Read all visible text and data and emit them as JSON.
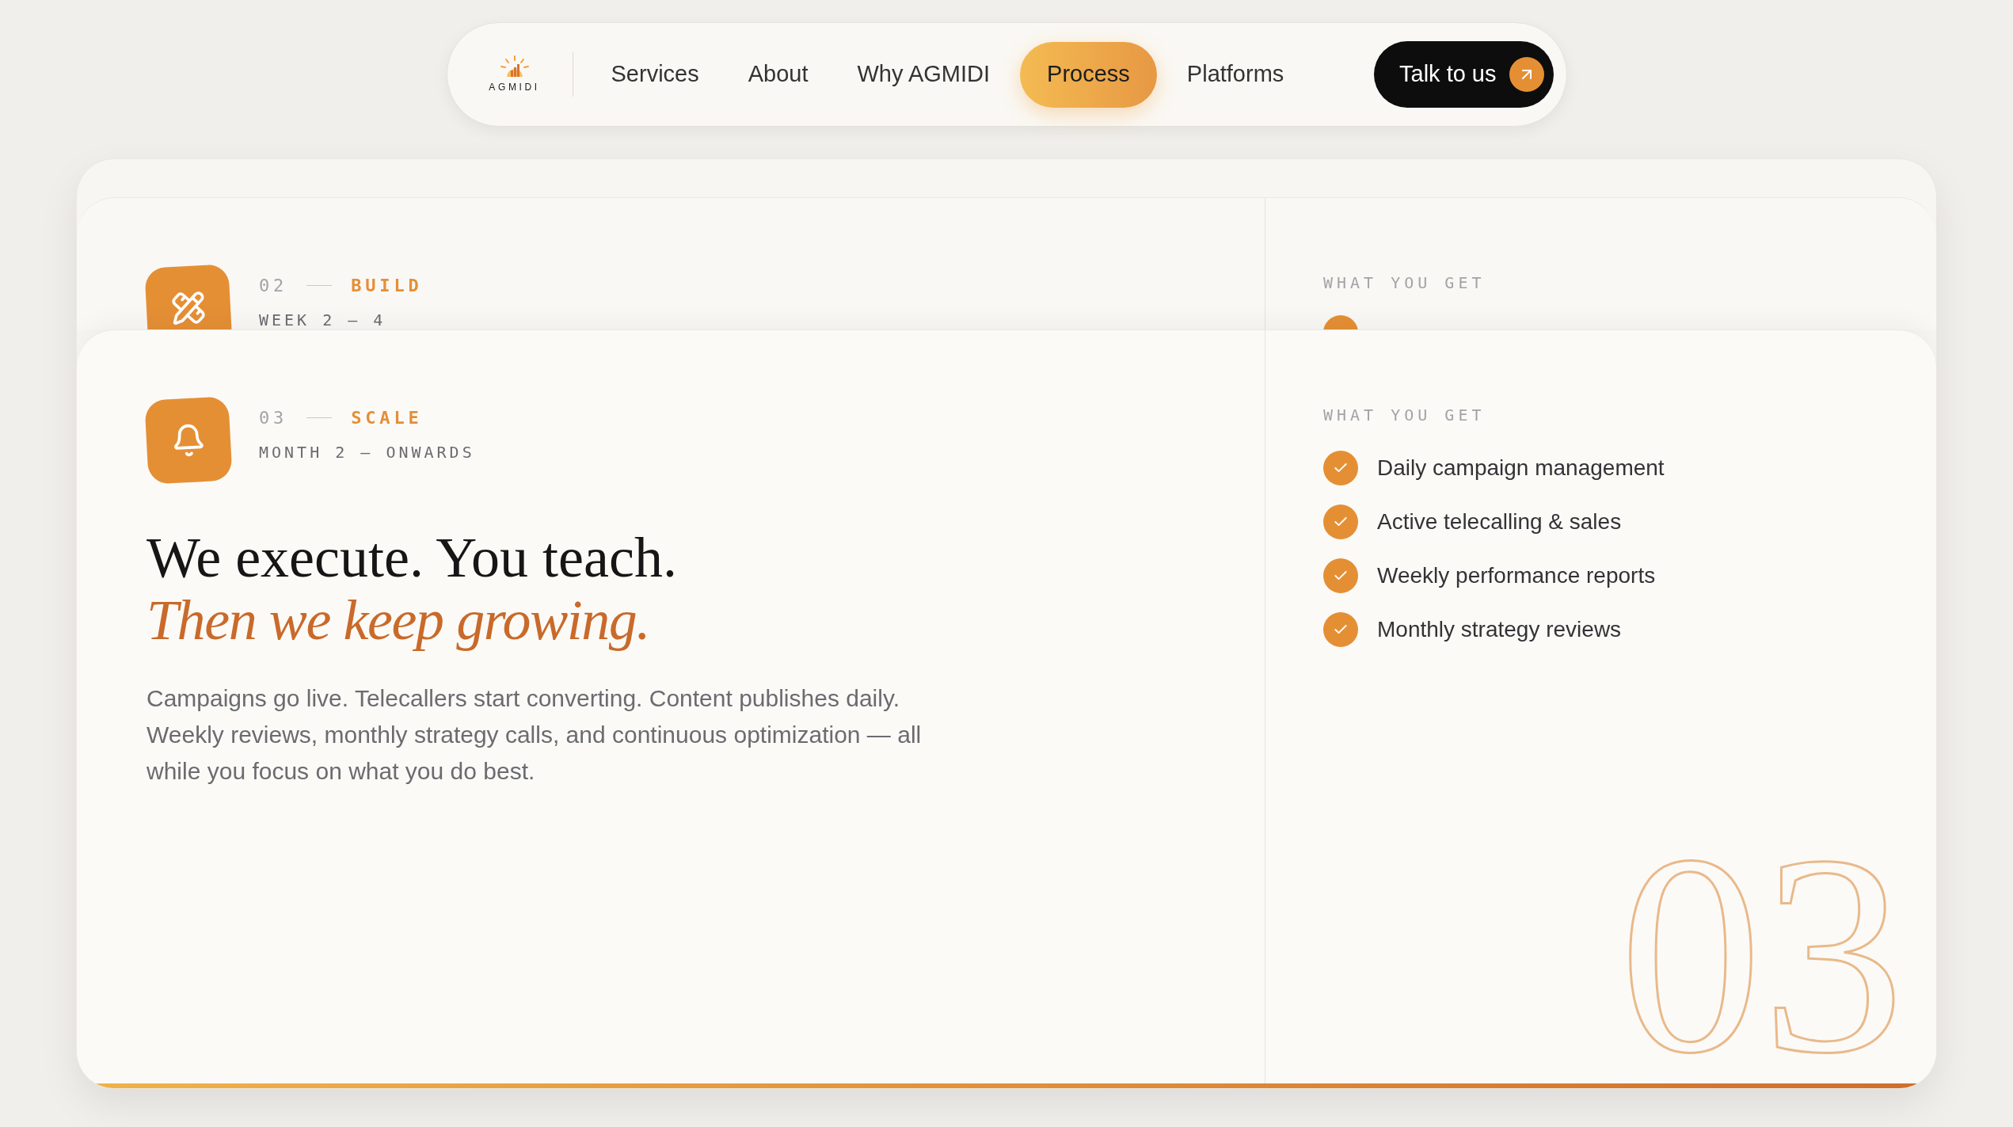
{
  "nav": {
    "logo": {
      "text": "AGMIDI"
    },
    "links": [
      {
        "label": "Services",
        "selected": false
      },
      {
        "label": "About",
        "selected": false
      },
      {
        "label": "Why AGMIDI",
        "selected": false
      },
      {
        "label": "Process",
        "selected": true
      },
      {
        "label": "Platforms",
        "selected": false
      }
    ],
    "cta": {
      "label": "Talk to us"
    }
  },
  "steps": [
    {
      "number": "02",
      "title": "BUILD",
      "period": "WEEK 2 — 4",
      "expanded": false,
      "benefits_heading": "WHAT YOU GET"
    },
    {
      "number": "03",
      "title": "SCALE",
      "period": "MONTH 2 — ONWARDS",
      "expanded": true,
      "level": 1,
      "heading": "We execute. You teach.",
      "heading_accent": "Then we keep growing.",
      "body": "Campaigns go live. Telecallers start converting. Content publishes daily. Weekly reviews, monthly strategy calls, and continuous optimization — all while you focus on what you do best.",
      "benefits_heading": "WHAT YOU GET",
      "benefits": [
        "Daily campaign management",
        "Active telecalling & sales",
        "Weekly performance reports",
        "Monthly strategy reviews"
      ],
      "watermark": "03"
    }
  ]
}
